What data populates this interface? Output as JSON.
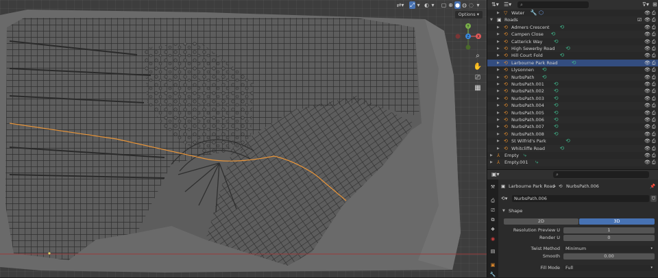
{
  "viewport": {
    "options_label": "Options"
  },
  "outliner": {
    "search_placeholder": "",
    "rows": [
      {
        "label": "Water",
        "indent": 1,
        "icon": "▽",
        "icon_color": "#e08a2c",
        "mods": "🔧 ⬡"
      },
      {
        "label": "Roads",
        "indent": 0,
        "icon": "▣",
        "icon_color": "#ddd",
        "collection": true
      },
      {
        "label": "Admers Crescent",
        "indent": 1,
        "mod": "⟲"
      },
      {
        "label": "Campen Close",
        "indent": 1,
        "mod": "⟲"
      },
      {
        "label": "Catterick Way",
        "indent": 1,
        "mod": "⟲"
      },
      {
        "label": "High Sewerby Road",
        "indent": 1,
        "mod": "⟲"
      },
      {
        "label": "Hill Court Fold",
        "indent": 1,
        "mod": "⟲"
      },
      {
        "label": "Larbourne Park Road",
        "indent": 1,
        "mod": "⟲",
        "selected": true
      },
      {
        "label": "Llysonnen",
        "indent": 1,
        "mod": "⟲"
      },
      {
        "label": "NurbsPath",
        "indent": 1,
        "mod": "⟲"
      },
      {
        "label": "NurbsPath.001",
        "indent": 1,
        "mod": "⟲"
      },
      {
        "label": "NurbsPath.002",
        "indent": 1,
        "mod": "⟲"
      },
      {
        "label": "NurbsPath.003",
        "indent": 1,
        "mod": "⟲"
      },
      {
        "label": "NurbsPath.004",
        "indent": 1,
        "mod": "⟲"
      },
      {
        "label": "NurbsPath.005",
        "indent": 1,
        "mod": "⟲"
      },
      {
        "label": "NurbsPath.006",
        "indent": 1,
        "mod": "⟲"
      },
      {
        "label": "NurbsPath.007",
        "indent": 1,
        "mod": "⟲"
      },
      {
        "label": "NurbsPath.008",
        "indent": 1,
        "mod": "⟲"
      },
      {
        "label": "St Wilfrid's Park",
        "indent": 1,
        "mod": "⟲"
      },
      {
        "label": "Whitcliffe Road",
        "indent": 1,
        "mod": "⟲"
      },
      {
        "label": "Empty",
        "indent": 0,
        "icon": "⅄",
        "icon_color": "#e08a2c",
        "mod": "⤷"
      },
      {
        "label": "Empty.001",
        "indent": 0,
        "icon": "⅄",
        "icon_color": "#e08a2c",
        "mod": "⤷"
      }
    ]
  },
  "properties": {
    "breadcrumb_object": "Larbourne Park Road",
    "breadcrumb_sep": ">",
    "breadcrumb_data": "NurbsPath.006",
    "data_name": "NurbsPath.006",
    "panel_title": "Shape",
    "dim_2d": "2D",
    "dim_3d": "3D",
    "resolution_preview_label": "Resolution Preview U",
    "resolution_preview_value": "1",
    "render_u_label": "Render U",
    "render_u_value": "0",
    "twist_method_label": "Twist Method",
    "twist_method_value": "Minimum",
    "smooth_label": "Smooth",
    "smooth_value": "0.00",
    "fill_mode_label": "Fill Mode",
    "fill_mode_value": "Full"
  },
  "colors": {
    "accent": "#4772b3",
    "selected_row": "#334d80",
    "road_highlight": "#e8953a",
    "modifier": "#3fb88c"
  }
}
